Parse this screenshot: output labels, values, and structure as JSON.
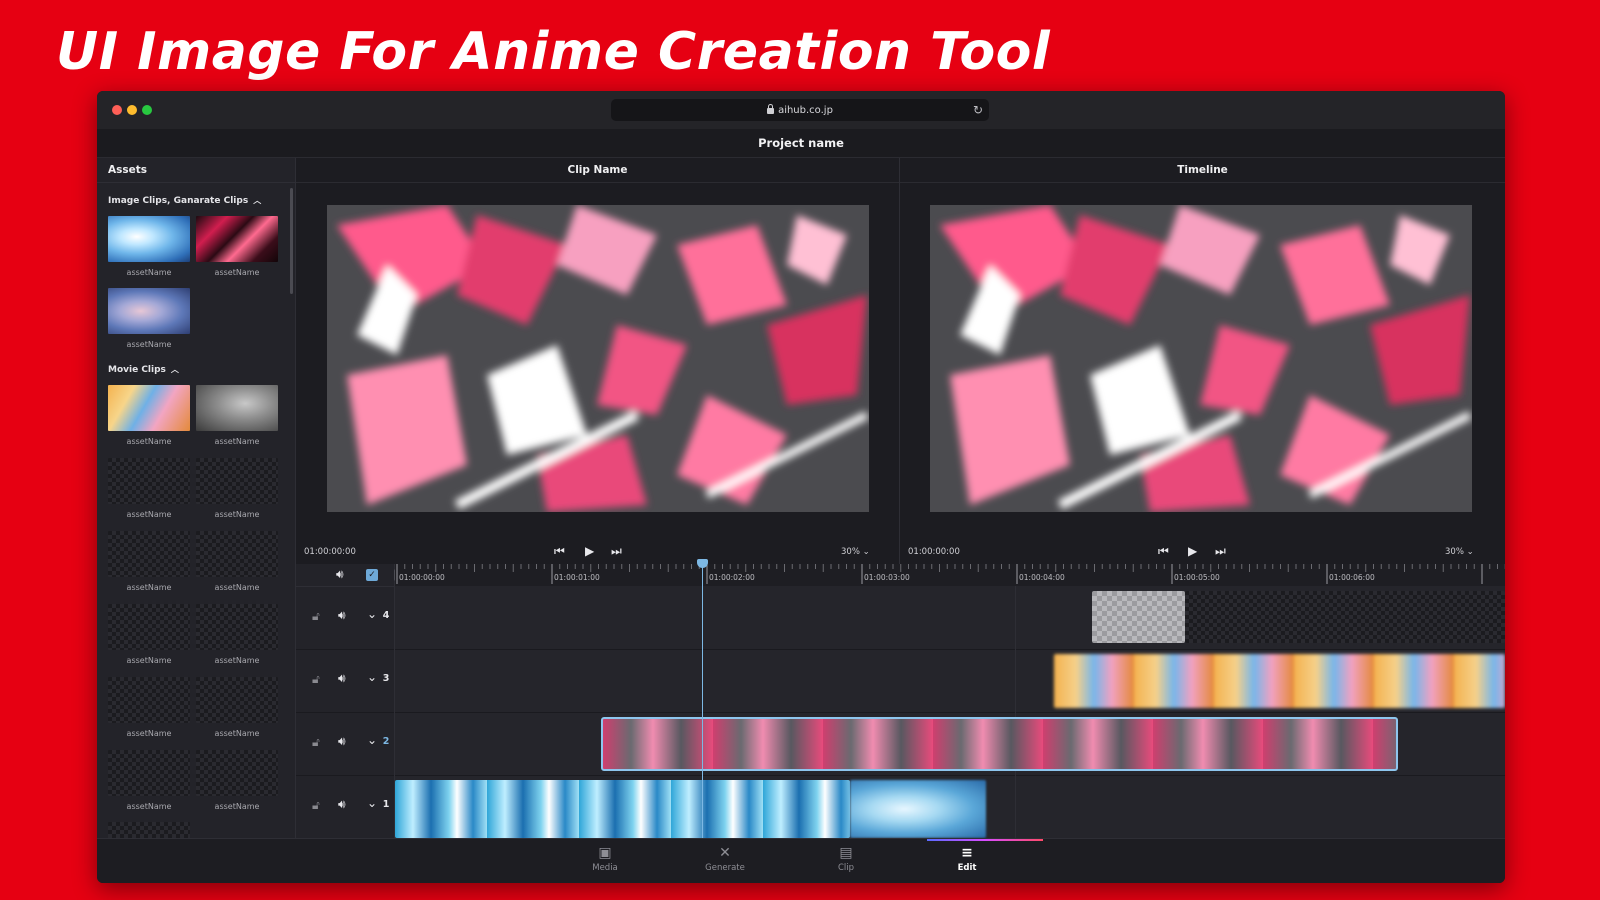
{
  "page": {
    "headline": "UI Image For Anime Creation Tool"
  },
  "browser": {
    "url": "aihub.co.jp"
  },
  "project": {
    "name": "Project name"
  },
  "assets": {
    "title": "Assets",
    "image_section": {
      "label": "Image Clips, Ganarate Clips",
      "items": [
        "assetName",
        "assetName",
        "assetName"
      ]
    },
    "movie_section": {
      "label": "Movie Clips",
      "items": [
        "assetName",
        "assetName",
        "assetName",
        "assetName",
        "assetName",
        "assetName",
        "assetName",
        "assetName",
        "assetName",
        "assetName",
        "assetName",
        "assetName"
      ]
    }
  },
  "clip_viewer": {
    "title": "Clip Name",
    "timecode": "01:00:00:00",
    "zoom": "30%"
  },
  "timeline_viewer": {
    "title": "Timeline",
    "timecode": "01:00:00:00",
    "zoom": "30%"
  },
  "timeline": {
    "ruler": [
      "01:00:00:00",
      "01:00:01:00",
      "01:00:02:00",
      "01:00:03:00",
      "01:00:04:00",
      "01:00:05:00",
      "01:00:06:00"
    ],
    "tracks": [
      "4",
      "3",
      "2",
      "1"
    ],
    "playhead_timecode": "01:00:01:20"
  },
  "nav": {
    "items": [
      {
        "label": "Media",
        "icon": "media-icon"
      },
      {
        "label": "Generate",
        "icon": "generate-icon"
      },
      {
        "label": "Clip",
        "icon": "clip-icon"
      },
      {
        "label": "Edit",
        "icon": "edit-icon"
      }
    ],
    "active": "Edit"
  },
  "colors": {
    "brand_red": "#e60012",
    "accent_blue": "#7db8e4",
    "panel": "#232329"
  }
}
